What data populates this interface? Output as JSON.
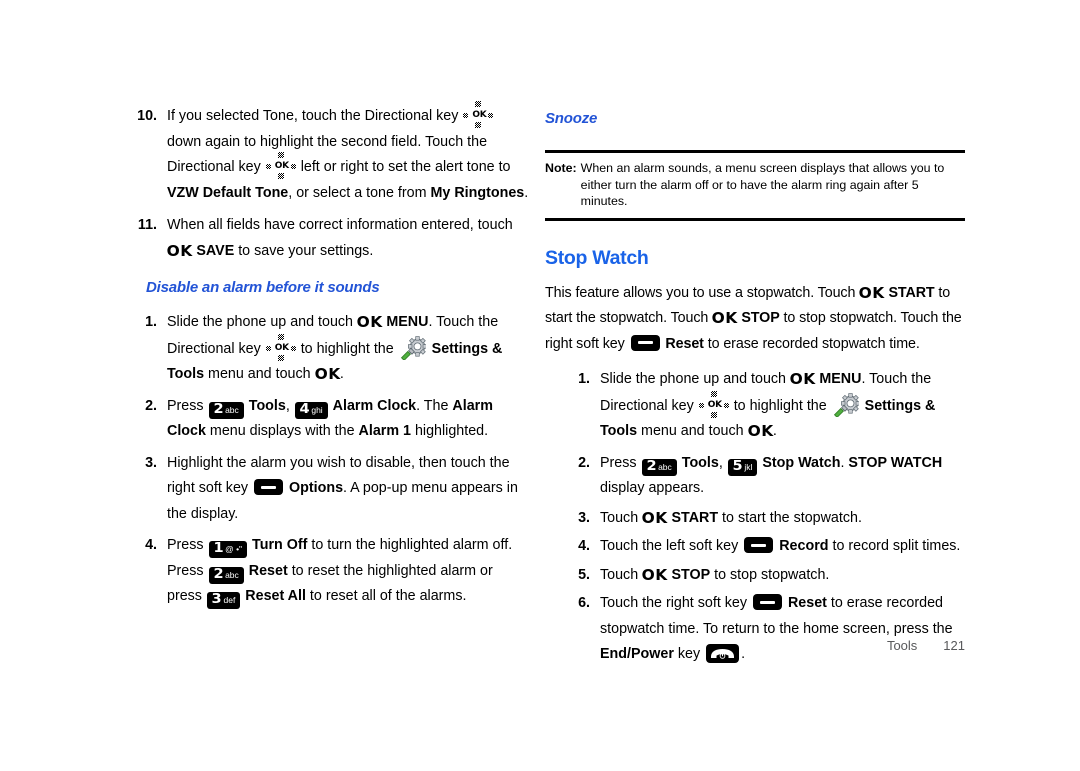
{
  "document": {
    "footer": {
      "section": "Tools",
      "page_number": "121"
    }
  },
  "left_column": {
    "step10": {
      "number": "10.",
      "t1": "If you selected Tone, touch the Directional key ",
      "t2": " down again to highlight the second field. Touch the Directional key ",
      "t3": " left or right to set the alert tone to ",
      "b1": "VZW Default Tone",
      "t4": ", or select a tone from ",
      "b2": "My Ringtones",
      "t5": "."
    },
    "step11": {
      "number": "11.",
      "t1": "When all fields have correct information entered, touch ",
      "ok": "OK",
      "b1": "SAVE",
      "t2": " to save your settings."
    },
    "subhead": "Disable an alarm before it sounds",
    "step1": {
      "number": "1.",
      "t1": "Slide the phone up and touch ",
      "ok1": "OK",
      "b1": "MENU",
      "t2": ". Touch the Directional key ",
      "t3": " to highlight the ",
      "b2": "Settings & Tools",
      "t4": " menu and touch ",
      "ok2": "OK",
      "t5": "."
    },
    "step2": {
      "number": "2.",
      "t1": "Press ",
      "key1_num": "2",
      "key1_sub": "abc",
      "b1": "Tools",
      "t2": ", ",
      "key2_num": "4",
      "key2_sub": "ghi",
      "b2": "Alarm Clock",
      "t3": ". The ",
      "b3": "Alarm Clock",
      "t4": " menu displays with the ",
      "b4": "Alarm 1",
      "t5": " highlighted."
    },
    "step3": {
      "number": "3.",
      "t1": "Highlight the alarm you wish to disable, then touch the right soft key ",
      "b1": "Options",
      "t2": ". A pop-up menu appears in the display."
    },
    "step4": {
      "number": "4.",
      "t1": "Press ",
      "key1_num": "1",
      "key1_sub": "@ •\"",
      "b1": "Turn Off",
      "t2": " to turn the highlighted alarm off. Press ",
      "key2_num": "2",
      "key2_sub": "abc",
      "b2": "Reset",
      "t3": " to reset the highlighted alarm or press ",
      "key3_num": "3",
      "key3_sub": "def",
      "b3": "Reset All",
      "t4": " to reset all of the alarms."
    }
  },
  "right_column": {
    "subhead": "Snooze",
    "note": {
      "label": "Note:",
      "text": "When an alarm sounds, a menu screen displays that allows you to either turn the alarm off or to have the alarm ring again after 5 minutes."
    },
    "section_head": "Stop Watch",
    "intro": {
      "t1": "This feature allows you to use a stopwatch. Touch ",
      "ok1": "OK",
      "b1": "START",
      "t2": " to start the stopwatch. Touch ",
      "ok2": "OK",
      "b2": "STOP",
      "t3": " to stop stopwatch. Touch the right soft key ",
      "b3": "Reset",
      "t4": " to erase recorded stopwatch time."
    },
    "step1": {
      "number": "1.",
      "t1": "Slide the phone up and touch ",
      "ok1": "OK",
      "b1": "MENU",
      "t2": ". Touch the Directional key ",
      "t3": " to highlight the ",
      "b2": "Settings & Tools",
      "t4": " menu and touch ",
      "ok2": "OK",
      "t5": "."
    },
    "step2": {
      "number": "2.",
      "t1": "Press ",
      "key1_num": "2",
      "key1_sub": "abc",
      "b1": "Tools",
      "t2": ", ",
      "key2_num": "5",
      "key2_sub": "jkl",
      "b2": "Stop Watch",
      "t3": ". ",
      "b3": "STOP WATCH",
      "t4": " display appears."
    },
    "step3": {
      "number": "3.",
      "t1": "Touch ",
      "ok": "OK",
      "b1": "START",
      "t2": " to start the stopwatch."
    },
    "step4": {
      "number": "4.",
      "t1": "Touch the left soft key ",
      "b1": "Record",
      "t2": " to record split times."
    },
    "step5": {
      "number": "5.",
      "t1": "Touch ",
      "ok": "OK",
      "b1": "STOP",
      "t2": " to stop stopwatch."
    },
    "step6": {
      "number": "6.",
      "t1": "Touch the right soft key ",
      "b1": "Reset",
      "t2": " to erase recorded stopwatch time. To return to the home screen, press the ",
      "b2": "End/Power",
      "t3": " key ",
      "t4": "."
    }
  },
  "colors": {
    "subhead_blue": "#2354d6",
    "section_blue": "#1a63e8",
    "footer_gray": "#58595b",
    "key_black": "#000000"
  },
  "icons": {
    "directional_key": "directional-key-icon",
    "ok_key": "ok-key-icon",
    "soft_key": "soft-key-icon",
    "end_power_key": "end-power-key-icon",
    "settings_tools": "settings-tools-gear-icon"
  }
}
